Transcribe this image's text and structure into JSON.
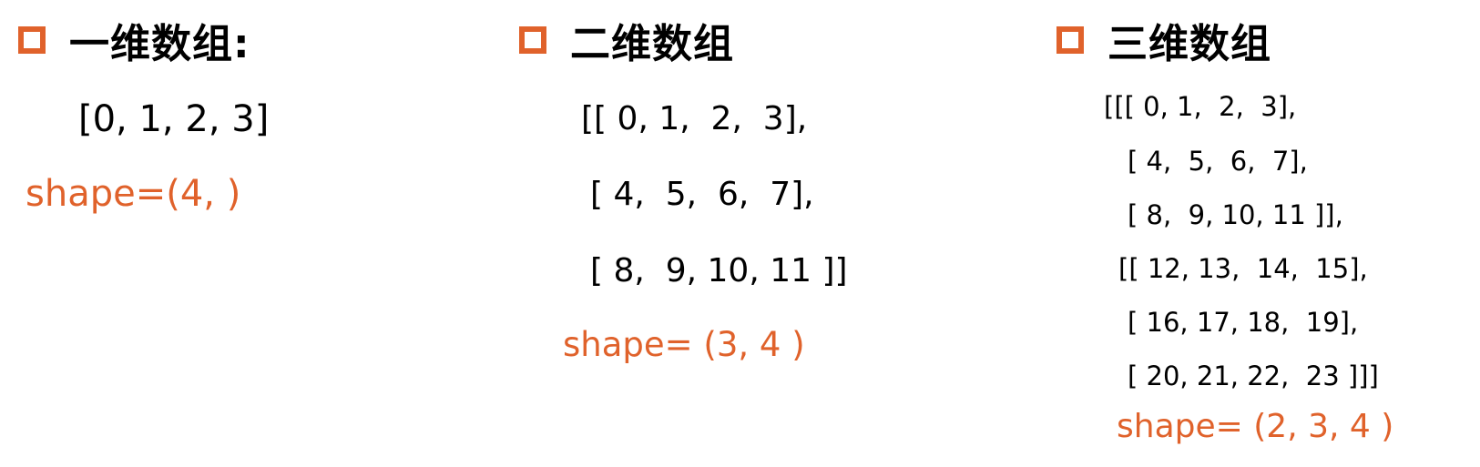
{
  "colors": {
    "accent": "#E0622B",
    "text": "#000000",
    "background": "#FFFFFF"
  },
  "sections": [
    {
      "heading": "一维数组:",
      "lines": [
        "[0, 1, 2, 3]"
      ],
      "shape": "shape=(4, )"
    },
    {
      "heading": "二维数组",
      "lines": [
        "[[ 0, 1,  2,  3],",
        "[ 4,  5,  6,  7],",
        "[ 8,  9, 10, 11 ]]"
      ],
      "shape": "shape= (3, 4 )"
    },
    {
      "heading": "三维数组",
      "lines": [
        "[[[ 0, 1,  2,  3],",
        "[ 4,  5,  6,  7],",
        "[ 8,  9, 10, 11 ]],",
        "[[ 12, 13,  14,  15],",
        "[ 16, 17, 18,  19],",
        "[ 20, 21, 22,  23 ]]]"
      ],
      "shape": "shape= (2, 3, 4 )"
    }
  ]
}
